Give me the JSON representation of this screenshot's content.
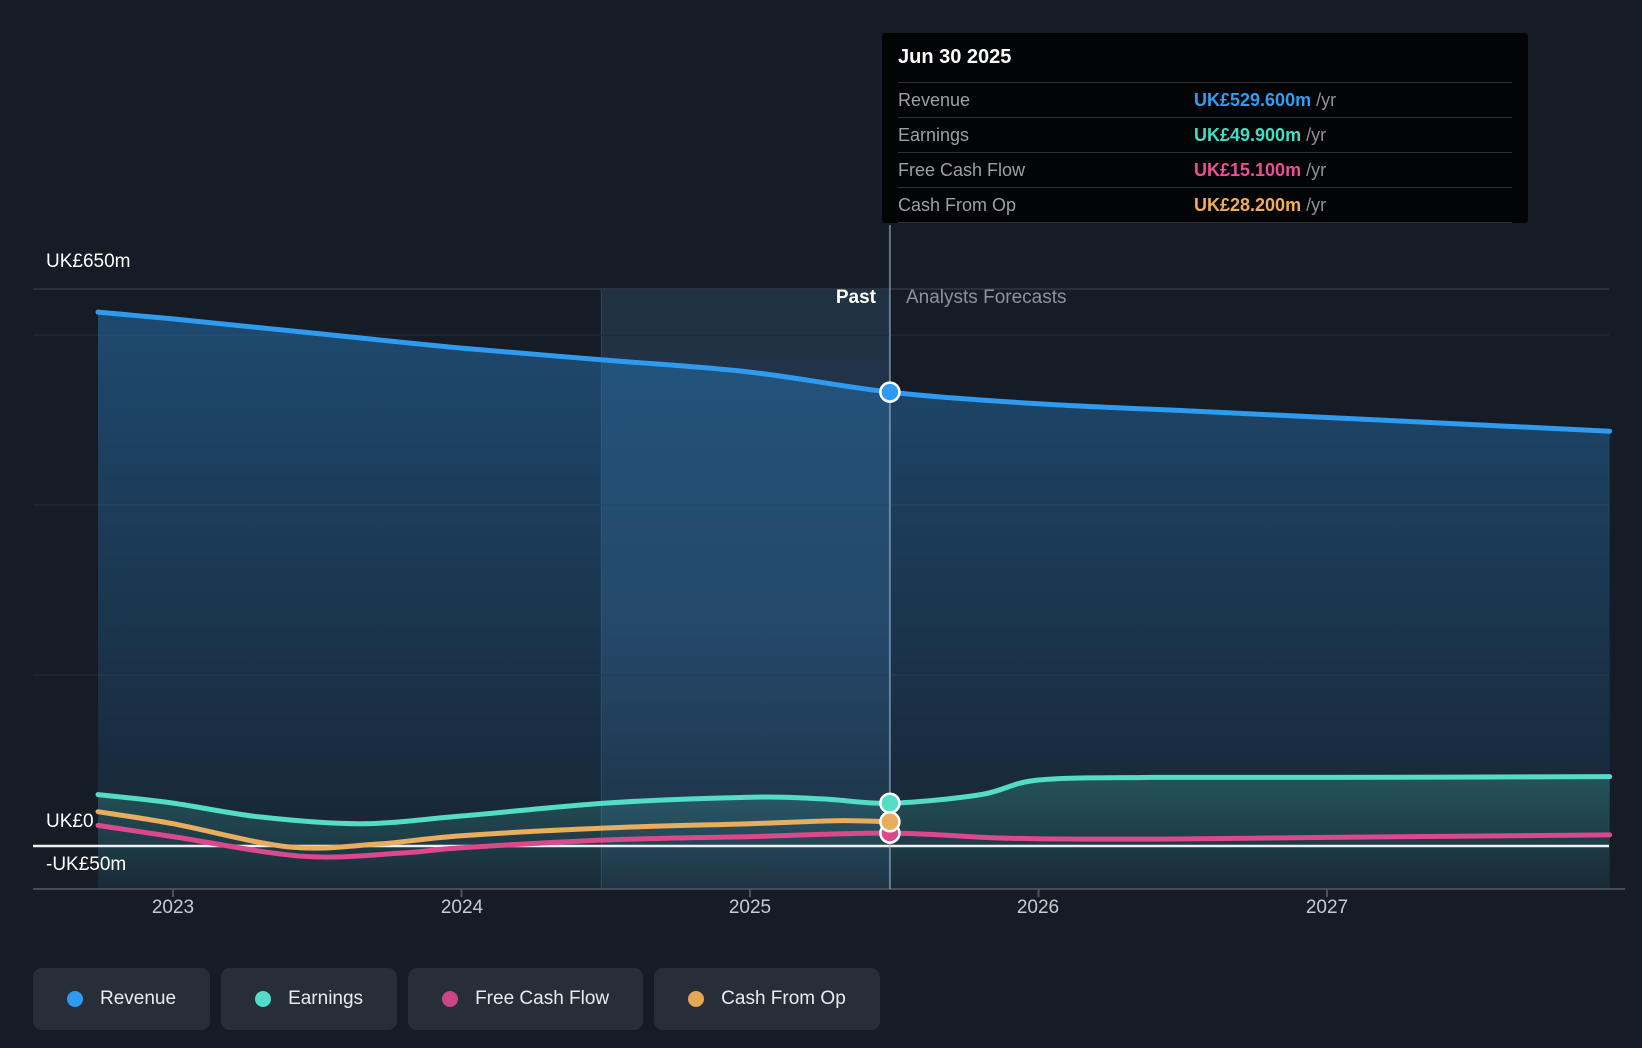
{
  "page": {
    "background": "#161c25"
  },
  "tooltip": {
    "date": "Jun 30 2025",
    "rows": [
      {
        "label": "Revenue",
        "value": "UK£529.600m",
        "suffix": " /yr",
        "color": "#2f9df5"
      },
      {
        "label": "Earnings",
        "value": "UK£49.900m",
        "suffix": " /yr",
        "color": "#43dcc4"
      },
      {
        "label": "Free Cash Flow",
        "value": "UK£15.100m",
        "suffix": " /yr",
        "color": "#ec4f96"
      },
      {
        "label": "Cash From Op",
        "value": "UK£28.200m",
        "suffix": " /yr",
        "color": "#f2ac52"
      }
    ]
  },
  "annotations": {
    "past": "Past",
    "forecast": "Analysts Forecasts"
  },
  "y_axis": {
    "labels": [
      "UK£650m",
      "UK£0",
      "-UK£50m"
    ]
  },
  "x_axis": {
    "ticks": [
      "2023",
      "2024",
      "2025",
      "2026",
      "2027"
    ]
  },
  "legend": [
    {
      "label": "Revenue",
      "color": "#2f9bf0"
    },
    {
      "label": "Earnings",
      "color": "#53dcc6"
    },
    {
      "label": "Free Cash Flow",
      "color": "#cb4687"
    },
    {
      "label": "Cash From Op",
      "color": "#e2a858"
    }
  ],
  "chart_data": {
    "type": "line",
    "title": "",
    "x_unit": "year",
    "xlim": [
      2022.6,
      2028.05
    ],
    "x_ticks": [
      2023,
      2024,
      2025,
      2026,
      2027
    ],
    "ylabel": "UK£ millions",
    "y_axis_labeled_values": [
      650,
      0,
      -50
    ],
    "grid": "horizontal-faint",
    "divider_x": 2025.485,
    "divider_date": "Jun 30 2025",
    "past_highlight_band": [
      2024.485,
      2025.485
    ],
    "legend_position": "bottom-left",
    "series": [
      {
        "name": "Revenue",
        "color": "#2f9bf0",
        "area": true,
        "marker_x": 2025.485,
        "marker_value": 529.6,
        "points": [
          [
            2022.74,
            623
          ],
          [
            2023.0,
            615
          ],
          [
            2023.5,
            598
          ],
          [
            2024.0,
            581
          ],
          [
            2024.5,
            567
          ],
          [
            2025.0,
            553
          ],
          [
            2025.485,
            529.6
          ],
          [
            2026.0,
            516
          ],
          [
            2026.5,
            508
          ],
          [
            2027.0,
            500
          ],
          [
            2027.98,
            484
          ]
        ]
      },
      {
        "name": "Earnings",
        "color": "#53dcc6",
        "area": true,
        "marker_x": 2025.485,
        "marker_value": 49.9,
        "points": [
          [
            2022.74,
            60
          ],
          [
            2023.0,
            50
          ],
          [
            2023.3,
            34
          ],
          [
            2023.65,
            26
          ],
          [
            2024.0,
            35
          ],
          [
            2024.5,
            50
          ],
          [
            2025.0,
            57
          ],
          [
            2025.25,
            55
          ],
          [
            2025.485,
            49.9
          ],
          [
            2025.8,
            60
          ],
          [
            2026.0,
            77
          ],
          [
            2026.4,
            80
          ],
          [
            2027.0,
            80
          ],
          [
            2027.98,
            81
          ]
        ]
      },
      {
        "name": "Cash From Op",
        "color": "#e9ad5e",
        "area": false,
        "marker_x": 2025.485,
        "marker_value": 28.2,
        "points": [
          [
            2022.74,
            40
          ],
          [
            2023.0,
            26
          ],
          [
            2023.4,
            -1
          ],
          [
            2023.7,
            2
          ],
          [
            2024.0,
            12
          ],
          [
            2024.5,
            21
          ],
          [
            2025.0,
            26
          ],
          [
            2025.3,
            29.5
          ],
          [
            2025.485,
            28.2
          ]
        ]
      },
      {
        "name": "Free Cash Flow",
        "color": "#d9498c",
        "area": false,
        "marker_x": 2025.485,
        "marker_value": 15.1,
        "points": [
          [
            2022.74,
            24
          ],
          [
            2023.0,
            11
          ],
          [
            2023.45,
            -12
          ],
          [
            2023.8,
            -8
          ],
          [
            2024.0,
            -2
          ],
          [
            2024.5,
            7
          ],
          [
            2025.0,
            11
          ],
          [
            2025.485,
            15.1
          ],
          [
            2025.9,
            9
          ],
          [
            2026.4,
            8
          ],
          [
            2027.0,
            10
          ],
          [
            2027.98,
            13
          ]
        ]
      }
    ]
  }
}
